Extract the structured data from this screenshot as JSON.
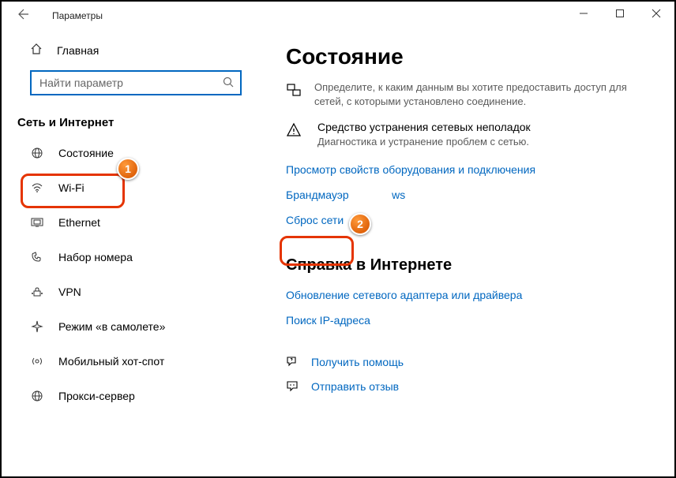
{
  "titlebar": {
    "title": "Параметры"
  },
  "sidebar": {
    "home": "Главная",
    "search_placeholder": "Найти параметр",
    "section": "Сеть и Интернет",
    "items": [
      {
        "label": "Состояние"
      },
      {
        "label": "Wi-Fi"
      },
      {
        "label": "Ethernet"
      },
      {
        "label": "Набор номера"
      },
      {
        "label": "VPN"
      },
      {
        "label": "Режим «в самолете»"
      },
      {
        "label": "Мобильный хот-спот"
      },
      {
        "label": "Прокси-сервер"
      }
    ]
  },
  "main": {
    "title": "Состояние",
    "sharing_desc": "Определите, к каким данным вы хотите предоставить доступ для сетей, с которыми установлено соединение.",
    "troubleshoot_title": "Средство устранения сетевых неполадок",
    "troubleshoot_desc": "Диагностика и устранение проблем с сетью.",
    "link_hw": "Просмотр свойств оборудования и подключения",
    "link_fw_prefix": "Брандмауэр",
    "link_fw_suffix": "ws",
    "link_reset": "Сброс сети",
    "help_title": "Справка в Интернете",
    "link_update": "Обновление сетевого адаптера или драйвера",
    "link_findip": "Поиск IP-адреса",
    "link_gethelp": "Получить помощь",
    "link_feedback": "Отправить отзыв"
  },
  "markers": {
    "one": "1",
    "two": "2"
  }
}
